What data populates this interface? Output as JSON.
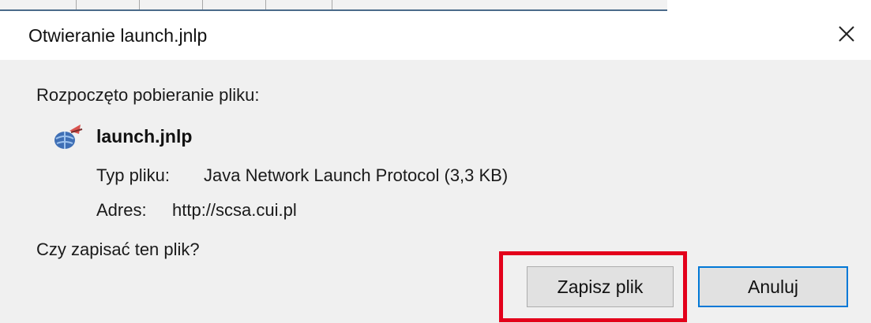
{
  "dialog": {
    "title": "Otwieranie launch.jnlp",
    "intro": "Rozpoczęto pobieranie pliku:",
    "file": {
      "name": "launch.jnlp",
      "icon": "java-jnlp-file-icon",
      "type_label": "Typ pliku:",
      "type_value": "Java Network Launch Protocol (3,3 KB)",
      "address_label": "Adres:",
      "address_value": "http://scsa.cui.pl"
    },
    "question": "Czy zapisać ten plik?",
    "buttons": {
      "save": "Zapisz plik",
      "cancel": "Anuluj"
    },
    "close_icon": "close-icon"
  },
  "colors": {
    "highlight_border": "#e3001b",
    "default_button_border": "#0078d7",
    "dialog_background": "#f0f0f0"
  }
}
